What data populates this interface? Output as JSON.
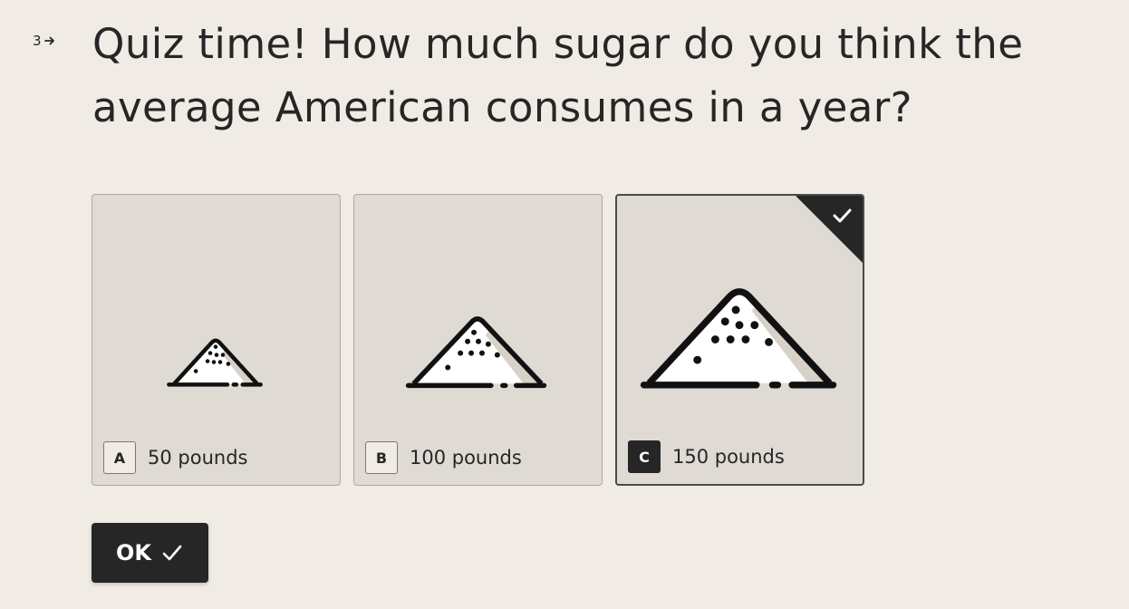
{
  "question": {
    "number": "3",
    "arrow_icon": "arrow-right-icon",
    "title": "Quiz time! How much sugar do you think the average American consumes in a year?"
  },
  "choices": [
    {
      "key": "A",
      "label": "50 pounds",
      "icon": "sugar-pile-small-icon",
      "selected": false
    },
    {
      "key": "B",
      "label": "100 pounds",
      "icon": "sugar-pile-medium-icon",
      "selected": false
    },
    {
      "key": "C",
      "label": "150 pounds",
      "icon": "sugar-pile-large-icon",
      "selected": true
    }
  ],
  "ok_button": {
    "label": "OK",
    "icon": "check-icon"
  },
  "colors": {
    "background": "#f0ebe4",
    "card": "#dfdad3",
    "text": "#262626",
    "button": "#262626"
  }
}
